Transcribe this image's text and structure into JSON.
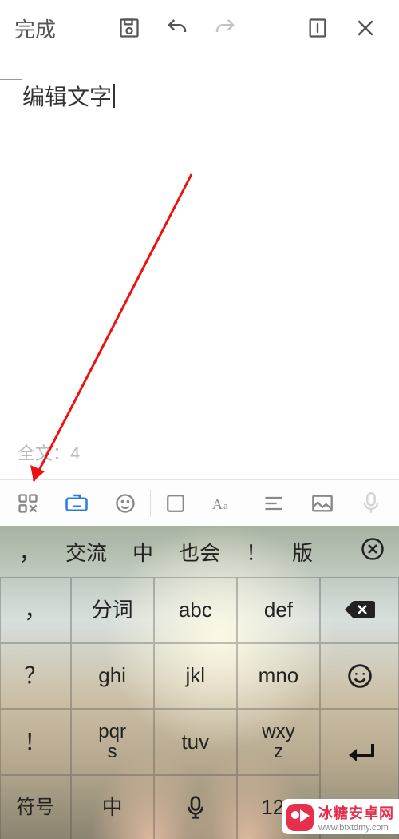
{
  "toolbar": {
    "done_label": "完成"
  },
  "editor": {
    "text": "编辑文字",
    "word_count_label": "全文：4"
  },
  "candidates": {
    "items": [
      "，",
      "交流",
      "中",
      "也会",
      "！",
      "版"
    ]
  },
  "keyboard": {
    "rows": [
      {
        "side_left": "，",
        "k1": "分词",
        "k2": "abc",
        "k3": "def",
        "side_right_icon": "backspace"
      },
      {
        "side_left": "？",
        "k1": "ghi",
        "k2": "jkl",
        "k3": "mno",
        "side_right_icon": "emoji"
      },
      {
        "side_left": "！",
        "k1": "pqr\ns",
        "k2": "tuv",
        "k3": "wxy\nz",
        "side_right_icon": "enter"
      },
      {
        "side_left": "符号",
        "k1": "中",
        "k2_icon": "mic",
        "k3": "123",
        "side_right_icon": "enter_cont"
      }
    ]
  },
  "watermark": {
    "title": "冰糖安卓网",
    "url": "www.btxtdmy.com"
  }
}
